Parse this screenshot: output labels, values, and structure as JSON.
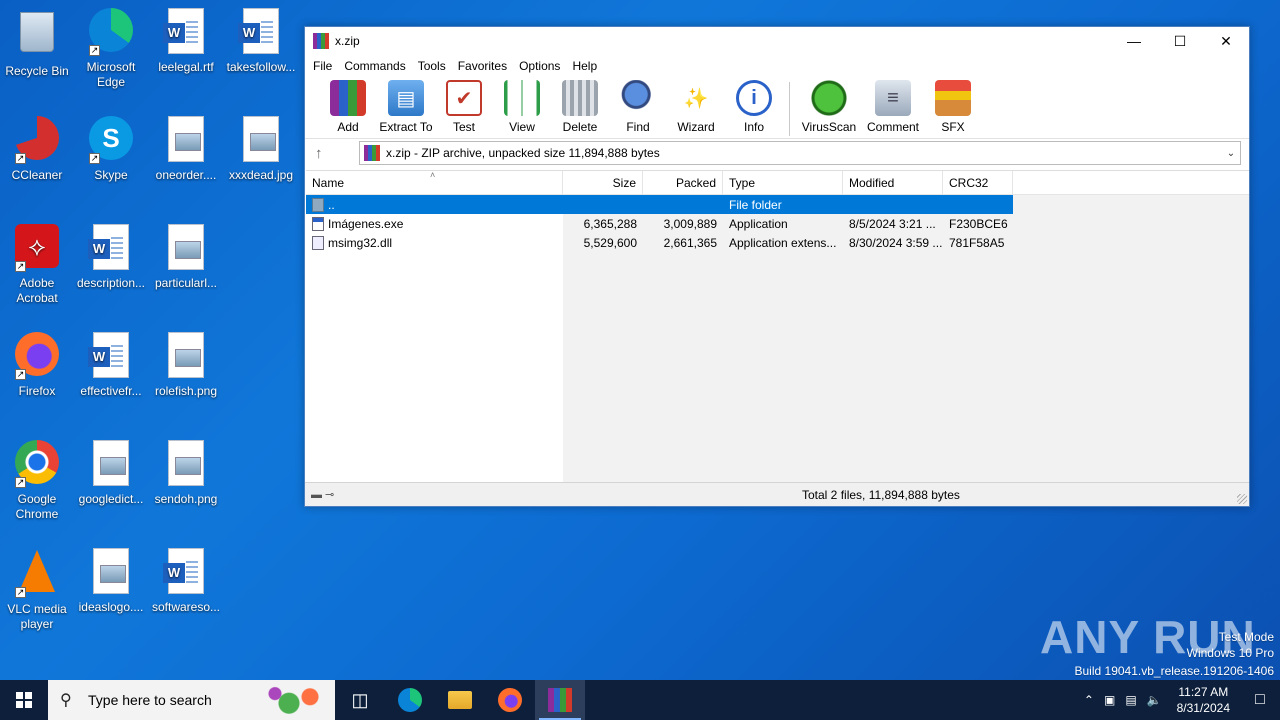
{
  "desktop": {
    "icons": [
      {
        "label": "Recycle Bin"
      },
      {
        "label": "Microsoft Edge"
      },
      {
        "label": "leelegal.rtf"
      },
      {
        "label": "takesfollow..."
      },
      {
        "label": "CCleaner"
      },
      {
        "label": "Skype"
      },
      {
        "label": "oneorder...."
      },
      {
        "label": "xxxdead.jpg"
      },
      {
        "label": "Adobe Acrobat"
      },
      {
        "label": "description..."
      },
      {
        "label": "particularl..."
      },
      {
        "label": "Firefox"
      },
      {
        "label": "effectivefr..."
      },
      {
        "label": "rolefish.png"
      },
      {
        "label": "Google Chrome"
      },
      {
        "label": "googledict..."
      },
      {
        "label": "sendoh.png"
      },
      {
        "label": "VLC media player"
      },
      {
        "label": "ideaslogo...."
      },
      {
        "label": "softwareso..."
      }
    ]
  },
  "window": {
    "title": "x.zip",
    "menu": [
      "File",
      "Commands",
      "Tools",
      "Favorites",
      "Options",
      "Help"
    ],
    "toolbar": [
      {
        "label": "Add",
        "icon": "add-archive-icon"
      },
      {
        "label": "Extract To",
        "icon": "extract-folder-icon"
      },
      {
        "label": "Test",
        "icon": "test-clipboard-icon"
      },
      {
        "label": "View",
        "icon": "book-icon"
      },
      {
        "label": "Delete",
        "icon": "trash-icon"
      },
      {
        "label": "Find",
        "icon": "magnifier-icon"
      },
      {
        "label": "Wizard",
        "icon": "wand-icon"
      },
      {
        "label": "Info",
        "icon": "info-icon"
      },
      {
        "label": "VirusScan",
        "icon": "bug-icon"
      },
      {
        "label": "Comment",
        "icon": "comment-icon"
      },
      {
        "label": "SFX",
        "icon": "box-icon"
      }
    ],
    "address": "x.zip - ZIP archive, unpacked size 11,894,888 bytes",
    "columns": [
      "Name",
      "Size",
      "Packed",
      "Type",
      "Modified",
      "CRC32"
    ],
    "rows": [
      {
        "name": "..",
        "size": "",
        "packed": "",
        "type": "File folder",
        "modified": "",
        "crc": ""
      },
      {
        "name": "Imágenes.exe",
        "size": "6,365,288",
        "packed": "3,009,889",
        "type": "Application",
        "modified": "8/5/2024 3:21 ...",
        "crc": "F230BCE6"
      },
      {
        "name": "msimg32.dll",
        "size": "5,529,600",
        "packed": "2,661,365",
        "type": "Application extens...",
        "modified": "8/30/2024 3:59 ...",
        "crc": "781F58A5"
      }
    ],
    "status": "Total 2 files, 11,894,888 bytes"
  },
  "watermark": {
    "brand": "ANY RUN",
    "line1": "Test Mode",
    "line2": "Windows 10 Pro",
    "line3": "Build 19041.vb_release.191206-1406"
  },
  "taskbar": {
    "search_placeholder": "Type here to search",
    "time": "11:27 AM",
    "date": "8/31/2024"
  }
}
